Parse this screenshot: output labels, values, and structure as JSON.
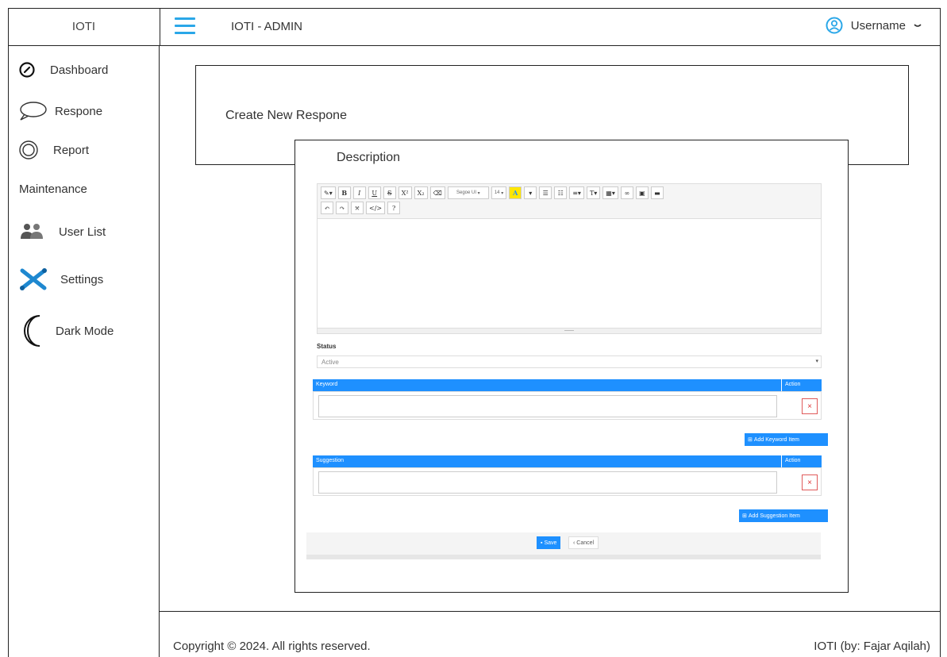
{
  "header": {
    "brand": "IOTI",
    "app_title": "IOTI - ADMIN",
    "username": "Username"
  },
  "sidebar": {
    "items": [
      {
        "label": "Dashboard",
        "icon": "speedometer-icon"
      },
      {
        "label": "Respone",
        "icon": "chat-bubble-icon"
      },
      {
        "label": "Report",
        "icon": "report-circle-icon"
      }
    ],
    "section_label": "Maintenance",
    "maintenance_items": [
      {
        "label": "User List",
        "icon": "users-icon"
      },
      {
        "label": "Settings",
        "icon": "tools-icon"
      },
      {
        "label": "Dark Mode",
        "icon": "moon-icon"
      }
    ]
  },
  "main": {
    "create_title": "Create New Respone",
    "form": {
      "description_label": "Description",
      "toolbar": {
        "font_name": "Segoe UI",
        "font_size": "14"
      },
      "status_label": "Status",
      "status_value": "Active",
      "keyword_header": "Keyword",
      "keyword_action_header": "Action",
      "add_keyword_label": "Add Keyword Item",
      "suggestion_header": "Suggestion",
      "suggestion_action_header": "Action",
      "add_suggestion_label": "Add Suggestion Item",
      "save_label": "Save",
      "cancel_label": "Cancel"
    }
  },
  "footer": {
    "copyright": "Copyright © 2024. All rights reserved.",
    "credits": "IOTI (by: Fajar Aqilah)"
  },
  "colors": {
    "accent": "#2aa7e8",
    "table_header": "#1e90ff",
    "delete": "#d33333"
  }
}
